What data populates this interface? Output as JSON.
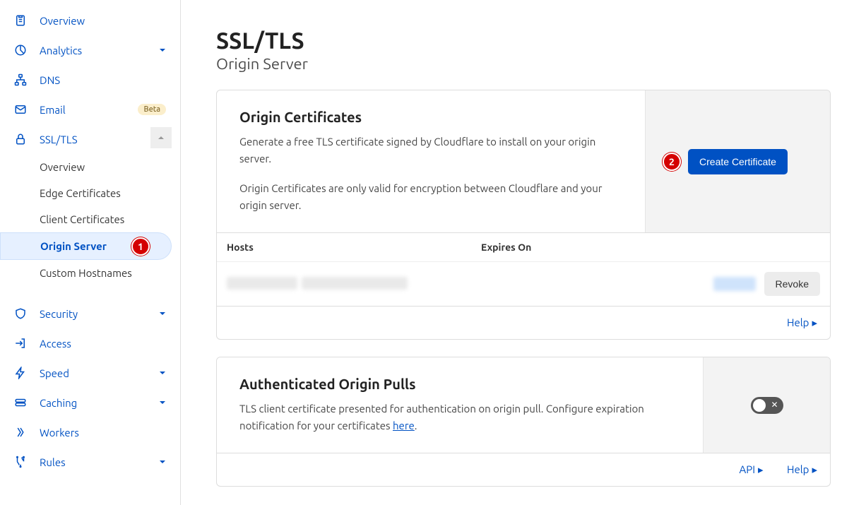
{
  "sidebar": {
    "items": {
      "overview": {
        "label": "Overview"
      },
      "analytics": {
        "label": "Analytics",
        "expandable": true
      },
      "dns": {
        "label": "DNS"
      },
      "email": {
        "label": "Email",
        "badge": "Beta"
      },
      "ssl": {
        "label": "SSL/TLS",
        "expandable": true,
        "expanded": true
      },
      "security": {
        "label": "Security",
        "expandable": true
      },
      "access": {
        "label": "Access"
      },
      "speed": {
        "label": "Speed",
        "expandable": true
      },
      "caching": {
        "label": "Caching",
        "expandable": true
      },
      "workers": {
        "label": "Workers"
      },
      "rules": {
        "label": "Rules",
        "expandable": true
      }
    },
    "ssl_sub": {
      "overview": {
        "label": "Overview"
      },
      "edge": {
        "label": "Edge Certificates"
      },
      "client": {
        "label": "Client Certificates"
      },
      "origin": {
        "label": "Origin Server"
      },
      "custom": {
        "label": "Custom Hostnames"
      }
    }
  },
  "page": {
    "title": "SSL/TLS",
    "subtitle": "Origin Server"
  },
  "origin_cert": {
    "title": "Origin Certificates",
    "desc1": "Generate a free TLS certificate signed by Cloudflare to install on your origin server.",
    "desc2": "Origin Certificates are only valid for encryption between Cloudflare and your origin server.",
    "create_btn": "Create Certificate",
    "columns": {
      "hosts": "Hosts",
      "expires": "Expires On"
    },
    "revoke_btn": "Revoke",
    "help_link": "Help"
  },
  "auth_pulls": {
    "title": "Authenticated Origin Pulls",
    "desc_a": "TLS client certificate presented for authentication on origin pull. Configure expiration notification for your certificates ",
    "desc_link": "here",
    "desc_b": ".",
    "toggle_on": false,
    "api_link": "API",
    "help_link": "Help"
  },
  "callouts": {
    "one": "1",
    "two": "2"
  }
}
